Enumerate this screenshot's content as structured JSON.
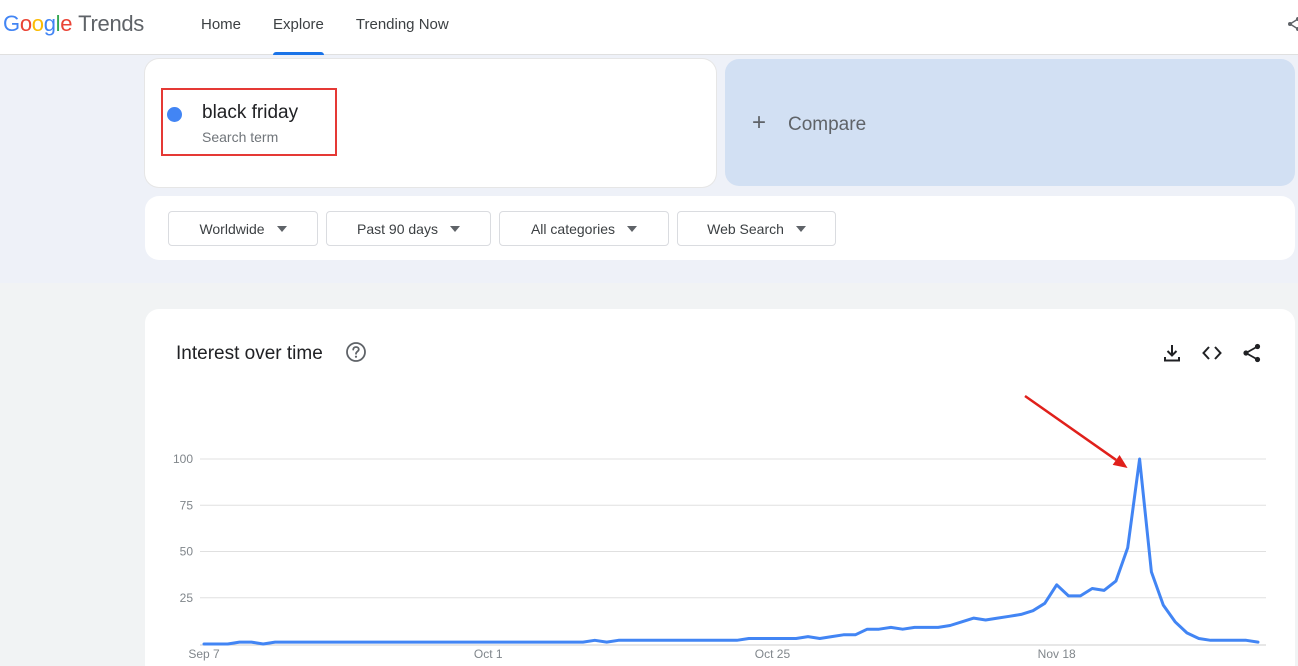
{
  "header": {
    "logo": {
      "letters": [
        {
          "char": "G",
          "color": "#4285F4"
        },
        {
          "char": "o",
          "color": "#EA4335"
        },
        {
          "char": "o",
          "color": "#FBBC05"
        },
        {
          "char": "g",
          "color": "#4285F4"
        },
        {
          "char": "l",
          "color": "#34A853"
        },
        {
          "char": "e",
          "color": "#EA4335"
        }
      ],
      "product": "Trends"
    },
    "tabs": [
      {
        "label": "Home",
        "active": false
      },
      {
        "label": "Explore",
        "active": true
      },
      {
        "label": "Trending Now",
        "active": false
      }
    ]
  },
  "search_term": {
    "term": "black friday",
    "type_label": "Search term",
    "color": "#4285F4"
  },
  "compare": {
    "plus": "+",
    "label": "Compare"
  },
  "filters": [
    {
      "label": "Worldwide"
    },
    {
      "label": "Past 90 days"
    },
    {
      "label": "All categories"
    },
    {
      "label": "Web Search"
    }
  ],
  "interest_over_time": {
    "title": "Interest over time",
    "icons": [
      "help-icon",
      "download-icon",
      "embed-icon",
      "share-icon"
    ]
  },
  "chart_data": {
    "type": "line",
    "title": "",
    "xlabel": "",
    "ylabel": "",
    "ylim": [
      0,
      100
    ],
    "y_ticks": [
      "100",
      "75",
      "50",
      "25"
    ],
    "x_tick_labels": [
      {
        "label": "Sep 7",
        "day": 0
      },
      {
        "label": "Oct 1",
        "day": 24
      },
      {
        "label": "Oct 25",
        "day": 48
      },
      {
        "label": "Nov 18",
        "day": 72
      }
    ],
    "grid": true,
    "line_color": "#4285F4",
    "annotation_color": "#E0201B",
    "series": [
      {
        "values": [
          0,
          0,
          0,
          1,
          1,
          0,
          1,
          1,
          1,
          1,
          1,
          1,
          1,
          1,
          1,
          1,
          1,
          1,
          1,
          1,
          1,
          1,
          1,
          1,
          1,
          1,
          1,
          1,
          1,
          1,
          1,
          1,
          1,
          2,
          1,
          2,
          2,
          2,
          2,
          2,
          2,
          2,
          2,
          2,
          2,
          2,
          3,
          3,
          3,
          3,
          3,
          4,
          3,
          4,
          5,
          5,
          8,
          8,
          9,
          8,
          9,
          9,
          9,
          10,
          12,
          14,
          13,
          14,
          15,
          16,
          18,
          22,
          32,
          26,
          26,
          30,
          29,
          34,
          52,
          100,
          39,
          21,
          12,
          6,
          3,
          2,
          2,
          2,
          2,
          1
        ]
      }
    ]
  }
}
